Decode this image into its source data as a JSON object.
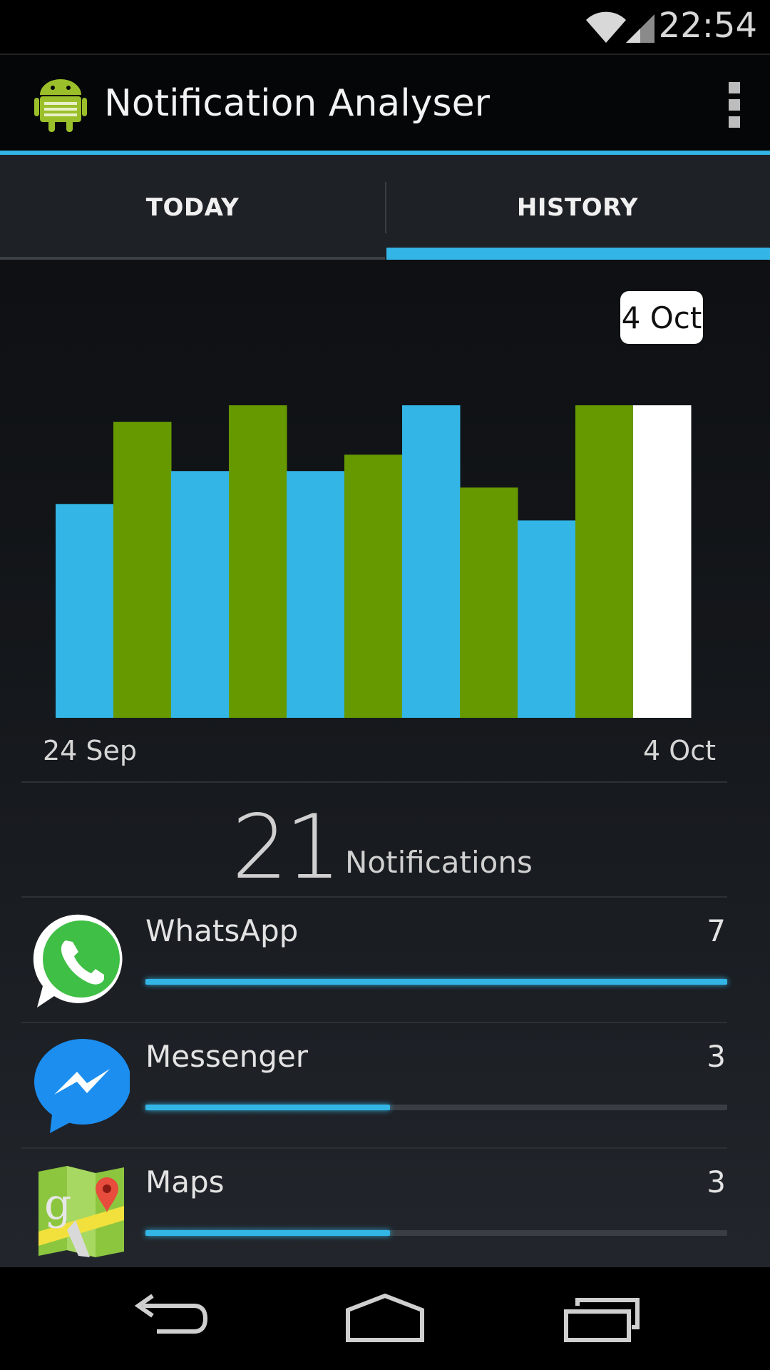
{
  "status_bar": {
    "time": "22:54"
  },
  "action_bar": {
    "title": "Notification Analyser"
  },
  "tabs": [
    {
      "label": "TODAY",
      "selected": false
    },
    {
      "label": "HISTORY",
      "selected": true
    }
  ],
  "chart_data": {
    "type": "bar",
    "title": "",
    "xlabel": "",
    "ylabel": "",
    "x_start_label": "24 Sep",
    "x_end_label": "4 Oct",
    "selected_label": "4 Oct",
    "ylim": [
      0,
      19
    ],
    "grid": false,
    "values": [
      13,
      18,
      15,
      19,
      15,
      16,
      19,
      14,
      12,
      19,
      19
    ],
    "colors": [
      "#33b5e5",
      "#669900",
      "#33b5e5",
      "#669900",
      "#33b5e5",
      "#669900",
      "#33b5e5",
      "#669900",
      "#33b5e5",
      "#669900",
      "#ffffff"
    ],
    "selected_index": 10
  },
  "summary": {
    "total": "21",
    "label": "Notifications"
  },
  "apps": [
    {
      "name": "WhatsApp",
      "count": "7",
      "progress": 1.0,
      "icon": "whatsapp-icon"
    },
    {
      "name": "Messenger",
      "count": "3",
      "progress": 0.42,
      "icon": "messenger-icon"
    },
    {
      "name": "Maps",
      "count": "3",
      "progress": 0.42,
      "icon": "maps-icon"
    }
  ],
  "colors": {
    "accent": "#33b5e5",
    "green": "#669900"
  }
}
